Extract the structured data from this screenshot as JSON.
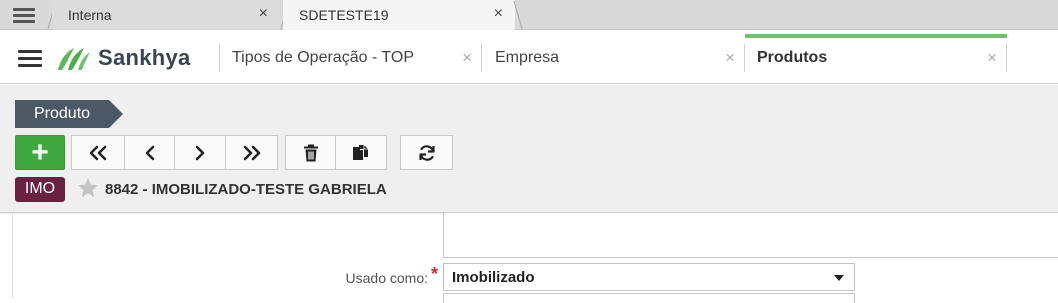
{
  "browser": {
    "tabs": [
      {
        "label": "Interna",
        "close": "×"
      },
      {
        "label": "SDETESTE19",
        "close": "×"
      }
    ]
  },
  "app": {
    "brand": "Sankhya",
    "tabs": [
      {
        "label": "Tipos de Operação - TOP",
        "close": "×"
      },
      {
        "label": "Empresa",
        "close": "×"
      },
      {
        "label": "Produtos",
        "close": "×",
        "active": true
      }
    ],
    "accent_color": "#6cc16c"
  },
  "toolbar": {
    "breadcrumb": "Produto",
    "add_label": "+",
    "icons": [
      "first-record-icon",
      "previous-record-icon",
      "next-record-icon",
      "last-record-icon",
      "trash-icon",
      "copy-icon",
      "refresh-icon"
    ],
    "add_color": "#3fa93f"
  },
  "record": {
    "badge": "IMO",
    "badge_color": "#6a2142",
    "title": "8842 - IMOBILIZADO-TESTE GABRIELA",
    "favorite": false
  },
  "form": {
    "usado_como": {
      "label": "Usado como:",
      "required_mark": "*",
      "value": "Imobilizado"
    }
  }
}
